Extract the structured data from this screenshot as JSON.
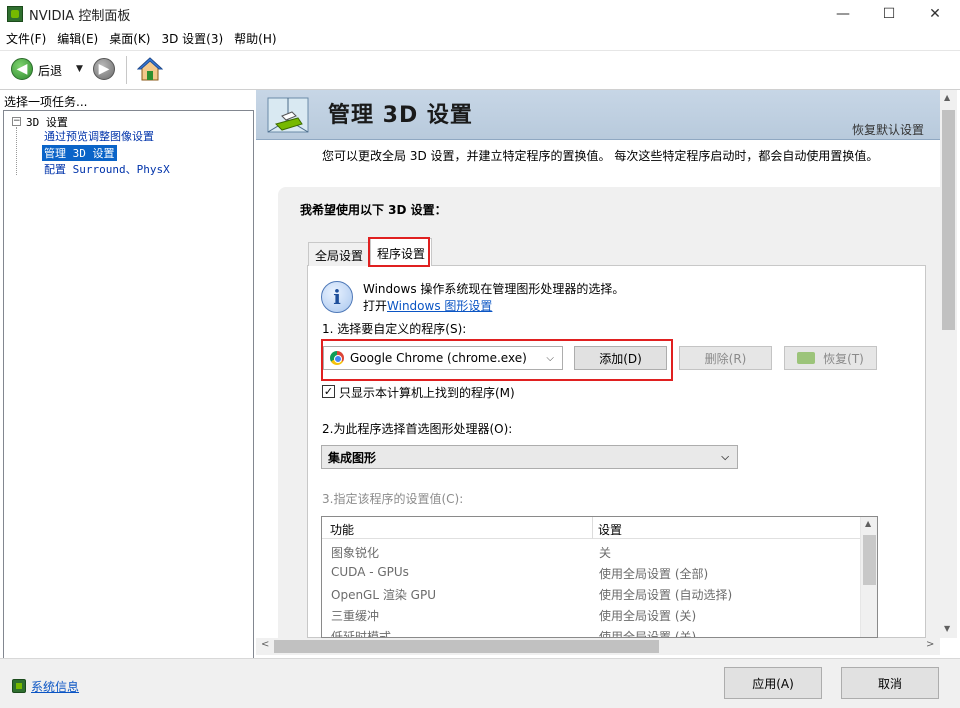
{
  "window": {
    "title": "NVIDIA 控制面板",
    "controls": {
      "minimize": "—",
      "maximize": "☐",
      "close": "✕"
    }
  },
  "menu": [
    "文件(F)",
    "编辑(E)",
    "桌面(K)",
    "3D 设置(3)",
    "帮助(H)"
  ],
  "toolbar": {
    "back_label": "后退"
  },
  "left_pane": {
    "heading": "选择一项任务...",
    "tree": {
      "root": "3D 设置",
      "children": [
        "通过预览调整图像设置",
        "管理 3D 设置",
        "配置 Surround、PhysX"
      ],
      "selected_index": 1
    }
  },
  "header": {
    "title": "管理 3D 设置",
    "restore_defaults": "恢复默认设置"
  },
  "description": "您可以更改全局 3D 设置，并建立特定程序的置换值。 每次这些特定程序启动时，都会自动使用置换值。",
  "panel": {
    "title": "我希望使用以下 3D 设置：",
    "tabs": [
      "全局设置",
      "程序设置"
    ],
    "active_tab": "程序设置",
    "info_line1": "Windows 操作系统现在管理图形处理器的选择。",
    "info_line2_prefix": "打开",
    "info_link": "Windows 图形设置",
    "step1_label": "1. 选择要自定义的程序(S):",
    "program_selected": "Google Chrome (chrome.exe)",
    "add_button": "添加(D)",
    "delete_button": "删除(R)",
    "restore_button": "恢复(T)",
    "show_only_label": "只显示本计算机上找到的程序(M)",
    "show_only_checked": true,
    "step2_label": "2.为此程序选择首选图形处理器(O):",
    "gpu_selected": "集成图形",
    "step3_label": "3.指定该程序的设置值(C):",
    "table": {
      "headers": [
        "功能",
        "设置"
      ],
      "rows": [
        [
          "图象锐化",
          "关"
        ],
        [
          "CUDA - GPUs",
          "使用全局设置 (全部)"
        ],
        [
          "OpenGL 渲染 GPU",
          "使用全局设置 (自动选择)"
        ],
        [
          "三重缓冲",
          "使用全局设置 (关)"
        ],
        [
          "低延时模式",
          "使用全局设置 (关)"
        ]
      ]
    }
  },
  "footer": {
    "system_info": "系统信息",
    "apply": "应用(A)",
    "cancel": "取消"
  },
  "colors": {
    "header_bg": "#c7d6e6",
    "selection": "#0a64c8",
    "link": "#0b55c4",
    "highlight_box": "#e02020"
  }
}
